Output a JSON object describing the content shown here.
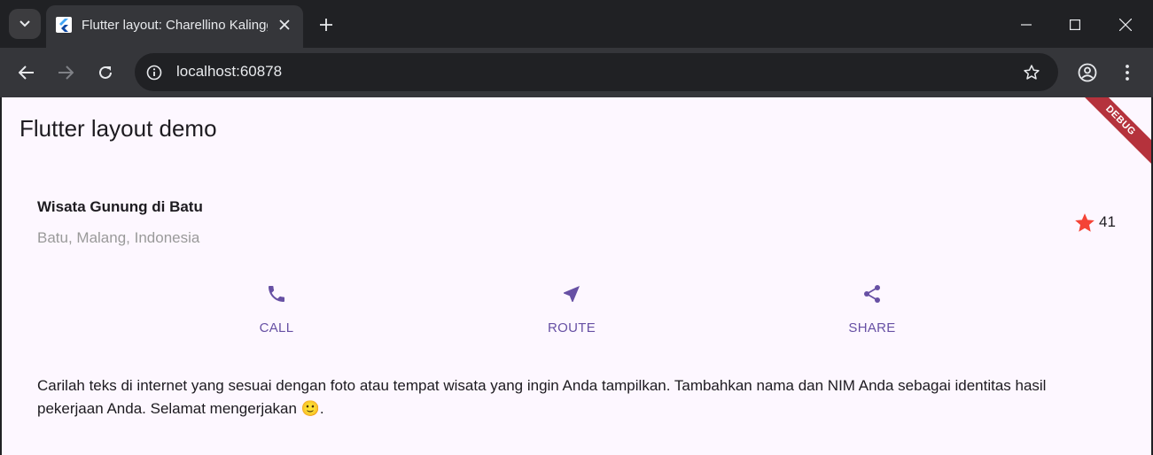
{
  "browser": {
    "tab_title": "Flutter layout: Charellino Kalingga",
    "url": "localhost:60878"
  },
  "app": {
    "title": "Flutter layout demo",
    "debug_banner": "DEBUG"
  },
  "location": {
    "name": "Wisata Gunung di Batu",
    "place": "Batu, Malang, Indonesia",
    "rating_count": "41"
  },
  "actions": [
    {
      "label": "CALL",
      "icon": "phone-icon"
    },
    {
      "label": "ROUTE",
      "icon": "near-me-icon"
    },
    {
      "label": "SHARE",
      "icon": "share-icon"
    }
  ],
  "description": "Carilah teks di internet yang sesuai dengan foto atau tempat wisata yang ingin Anda tampilkan. Tambahkan nama dan NIM Anda sebagai identitas hasil pekerjaan Anda. Selamat mengerjakan 🙂.",
  "colors": {
    "accent": "#6750a4",
    "star": "#f44336",
    "page_bg": "#fdf7ff"
  }
}
